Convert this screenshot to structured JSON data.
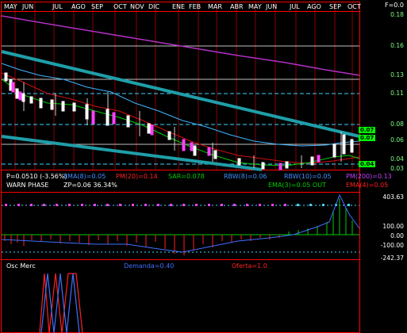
{
  "header": {
    "months": [
      "MAY",
      "JUN",
      "JUL",
      "AGO",
      "SEP",
      "OCT",
      "NOV",
      "DIC",
      "ENE",
      "FEB",
      "MAR",
      "ABR",
      "MAY",
      "JUN",
      "JUL",
      "AGO",
      "SEP",
      "OCT"
    ],
    "f_value": "F=0.0"
  },
  "price_panel": {
    "right_axis": [
      "0.18",
      "0.16",
      "0.13",
      "0.11",
      "0.08",
      "0.06",
      "0.04",
      "0.03"
    ],
    "current_tags": [
      {
        "text": "0.07",
        "color": "#00ff00"
      },
      {
        "text": "0.07",
        "color": "#00ff00"
      },
      {
        "text": "0.04",
        "color": "#00ff00"
      }
    ]
  },
  "indicators": {
    "line1": [
      {
        "text": "P=0.0510 (-3.56%)",
        "color": "#ffffff"
      },
      {
        "text": "EMA(8)=0.05",
        "color": "#3f8fff"
      },
      {
        "text": "PM(20)=0.14",
        "color": "#ff2020"
      },
      {
        "text": "SAR=0.078",
        "color": "#00cc00"
      },
      {
        "text": "RBW(8)=0.06",
        "color": "#3f8fff"
      },
      {
        "text": "RBW(10)=0.05",
        "color": "#3f8fff"
      },
      {
        "text": "PM(200)=0.13",
        "color": "#c040ff"
      }
    ],
    "line2": [
      {
        "text": "WARN PHASE",
        "color": "#ffffff"
      },
      {
        "text": "ZP=0.06 36.34%",
        "color": "#ffffff"
      },
      {
        "text": "EMA(3)=0.05 OUT",
        "color": "#00cc00"
      },
      {
        "text": "EMA(4)=0.05",
        "color": "#ff2020"
      }
    ]
  },
  "macd_panel": {
    "axis": [
      "403.63",
      "100.00",
      "0.00",
      "-100.00",
      "-242.37"
    ]
  },
  "osc_panel": {
    "title": "Osc Merc",
    "demand": "Demanda=0.40",
    "offer": "Oferta=1.0"
  },
  "colors": {
    "grid": "#ff0000",
    "trend": "#1f9ea8",
    "ma200": "#b030c0",
    "ma20": "#d01010",
    "ema": "#3fb6ff",
    "candle_up": "#ffffff",
    "candle_down": "#ff40ff"
  }
}
